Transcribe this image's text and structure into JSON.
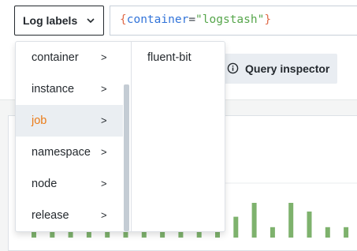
{
  "log_labels_button": {
    "label": "Log labels"
  },
  "query": {
    "open_brace": "{",
    "key": "container",
    "operator": "=",
    "value": "\"logstash\"",
    "close_brace": "}"
  },
  "query_inspector": {
    "label": "Query inspector"
  },
  "cascader": {
    "labels": [
      {
        "label": "container",
        "arrow": ">"
      },
      {
        "label": "instance",
        "arrow": ">"
      },
      {
        "label": "job",
        "arrow": ">"
      },
      {
        "label": "namespace",
        "arrow": ">"
      },
      {
        "label": "node",
        "arrow": ">"
      },
      {
        "label": "release",
        "arrow": ">"
      }
    ],
    "selected_index": 2,
    "values": [
      "fluent-bit"
    ]
  },
  "chart_data": {
    "type": "bar",
    "values": [
      0.3,
      0.3,
      0.3,
      0.3,
      0.3,
      0.3,
      0.3,
      0.3,
      0.3,
      0.3,
      0.75,
      0.6,
      1.0,
      0.3,
      1.0,
      0.75,
      0.3,
      0.3,
      0.5
    ],
    "color": "#7eb26d"
  },
  "colors": {
    "accent": "#eb7b18",
    "bar": "#7eb26d"
  }
}
